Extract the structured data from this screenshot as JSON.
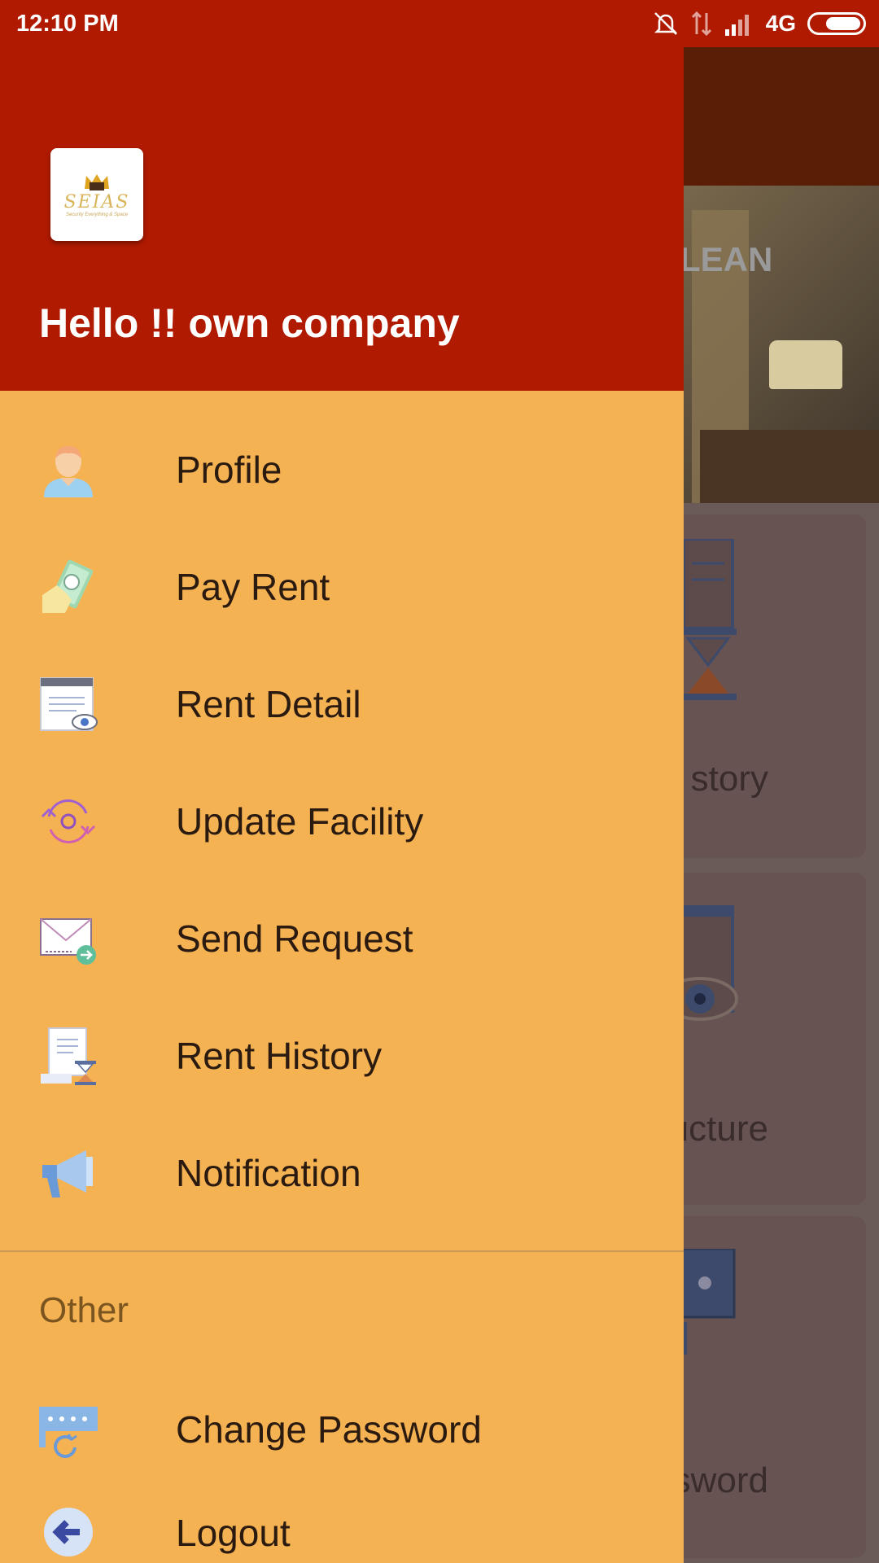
{
  "status_bar": {
    "time": "12:10 PM",
    "network": "4G",
    "icons": [
      "mute-bell-icon",
      "data-transfer-icon",
      "signal-icon",
      "battery-icon"
    ]
  },
  "drawer": {
    "greeting": "Hello !! own company",
    "logo_text": "SEIAS",
    "logo_subtitle": "Security Everything & Space",
    "menu_items": [
      {
        "label": "Profile",
        "icon": "profile-icon"
      },
      {
        "label": "Pay Rent",
        "icon": "pay-rent-icon"
      },
      {
        "label": "Rent Detail",
        "icon": "rent-detail-icon"
      },
      {
        "label": "Update Facility",
        "icon": "update-facility-icon"
      },
      {
        "label": "Send Request",
        "icon": "send-request-icon"
      },
      {
        "label": "Rent History",
        "icon": "rent-history-icon"
      },
      {
        "label": "Notification",
        "icon": "notification-icon"
      }
    ],
    "other_section_label": "Other",
    "other_items": [
      {
        "label": "Change Password",
        "icon": "change-password-icon"
      },
      {
        "label": "Logout",
        "icon": "logout-icon"
      }
    ]
  },
  "background": {
    "banner_title": "LEAN",
    "card_labels": [
      "story",
      "ucture",
      "ssword"
    ]
  },
  "colors": {
    "header_red": "#b01a00",
    "drawer_bg": "#f4b252",
    "text_dark": "#2b1a10",
    "section_text": "#7a5520"
  }
}
